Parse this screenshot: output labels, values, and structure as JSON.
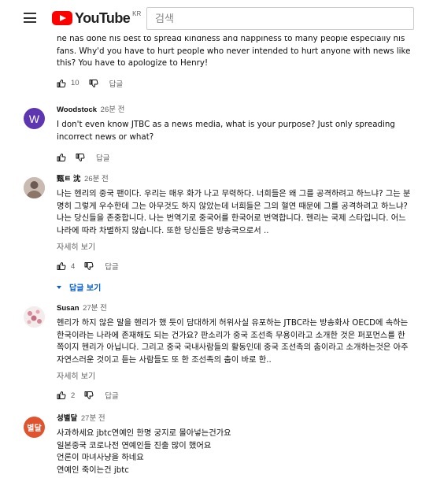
{
  "header": {
    "logo_text": "YouTube",
    "region": "KR",
    "search_placeholder": "검색"
  },
  "colors": {
    "youtube_red": "#ff0000",
    "link_blue": "#065fd4",
    "meta_gray": "#606060"
  },
  "comments": [
    {
      "text": "he has done his best to spread kindness and happiness to many people especially his fans. Why'd you have to hurt people who never intended to hurt anyone with news like this?  You have to apologize to Henry!",
      "likes": "10",
      "reply_label": "답글"
    },
    {
      "author": "Woodstock",
      "time": "26분 전",
      "avatar_letter": "W",
      "avatar_color": "#5e35b1",
      "text": "I don't even know JTBC as a news media, what is your purpose?  Just only spreading incorrect news or what?",
      "reply_label": "답글"
    },
    {
      "author": "甄ㅌ 沈",
      "time": "26분 전",
      "avatar_icon": "person-photo-icon",
      "text": "나는 헨리의 중국 팬이다. 우리는 매우 화가 나고 무력하다. 너희들은 왜 그를 공격하려고 하느냐? 그는 분명히 그렇게 우수한데 그는 아무것도 하지 않았는데 너희들은 그의 혈연 때문에 그를 공격하려고 하느냐?나는 당신들을 존중합니다. 나는 번역기로 중국어를 한국어로 번역합니다. 헨리는 국제 스타입니다. 어느 나라에 따라 차별하지 않습니다. 또한 당신들은 방송국으로서 ..",
      "more_label": "자세히 보기",
      "likes": "4",
      "reply_label": "답글",
      "replies_label": "답글 보기"
    },
    {
      "author": "Susan",
      "time": "27분 전",
      "avatar_icon": "flower-photo-icon",
      "text": "헨리가 하지 않은 말을 헨리가 했 듯이 담대하게 허위사실 유포하는 JTBC라는 방송화사 OECD에 속하는 한국이라는 나라에 존재해도 되는 건가요? 판소리가 중국 조선족 무용이라고 소개한 것은 퍼포먼스를 한 쪽이지 헨리가 아닙니다. 그리고 중국 국내사람들의 활동인데 중국 조선족의 춤이라고 소개하는것은 아주 자연스러운 것이고 듣는 사람들도 또 한 조선족의 춤이 바로 한..",
      "more_label": "자세히 보기",
      "likes": "2",
      "reply_label": "답글"
    },
    {
      "author": "성별달",
      "time": "27분 전",
      "avatar_letter": "별달",
      "avatar_color": "#e0532f",
      "text": "사과하세요 jbtc연예인  한명 궁지로 몰아넣는건가요\n일본중국 코로나전 연예인들 진출 많이 했어요\n언론이 마녀사냥을 하네요\n연예인 죽이는건 jbtc"
    }
  ]
}
